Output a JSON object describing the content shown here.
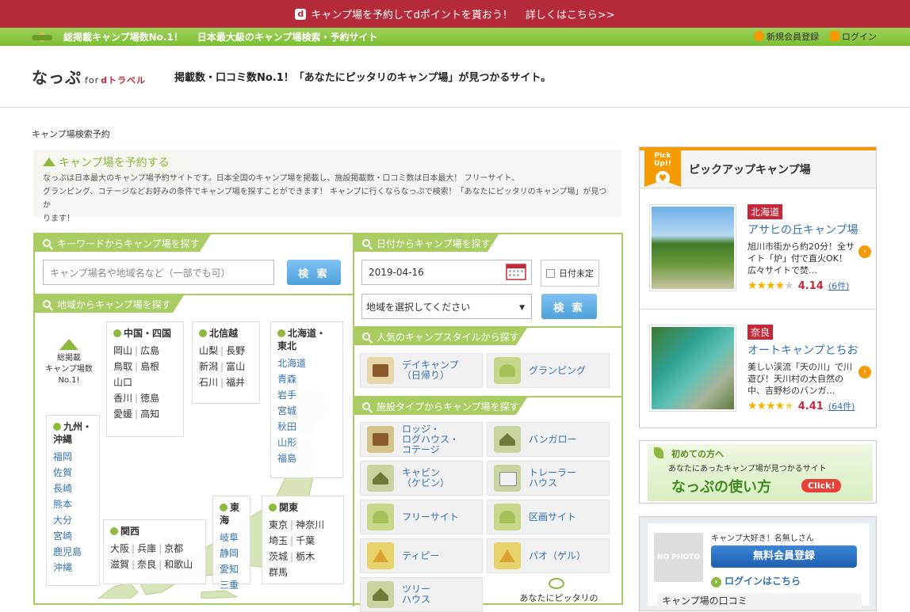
{
  "promo": {
    "icon": "d",
    "text": "キャンプ場を予約してdポイントを貰おう！",
    "more": "詳しくはこちら>>"
  },
  "topbar": {
    "catch1": "総掲載キャンプ場数No.1！",
    "catch2": "日本最大級のキャンプ場検索・予約サイト",
    "signup": "新規会員登録",
    "login": "ログイン"
  },
  "header": {
    "logo": "なっぷ",
    "logo_for": "for",
    "logo_d": "dトラベル",
    "tagline": "掲載数・口コミ数No.1！「あなたにピッタリのキャンプ場」が見つかるサイト。"
  },
  "breadcrumb": "キャンプ場検索予約",
  "intro": {
    "title": "キャンプ場を予約する",
    "line1": "なっぷは日本最大のキャンプ場予約サイトです。日本全国のキャンプ場を掲載し、施設掲載数・口コミ数は日本最大！ フリーサイト、",
    "line2": "グランピング、コテージなどお好みの条件でキャンプ場を探すことができます！ キャンプに行くならなっぷで検索！「あなたにピッタリのキャンプ場」が見つか",
    "line3": "ります！"
  },
  "keyword": {
    "header": "キーワードからキャンプ場を探す",
    "placeholder": "キャンプ場名や地域名など（一部でも可）",
    "button": "検 索"
  },
  "date": {
    "header": "日付からキャンプ場を探す",
    "value": "2019-04-16",
    "undecided": "日付未定",
    "area_placeholder": "地域を選択してください",
    "button": "検 索"
  },
  "area": {
    "header": "地域からキャンプ場を探す",
    "count_line1": "総掲載",
    "count_line2": "キャンプ場数",
    "count_line3": "No.1!"
  },
  "regions": {
    "chugoku": {
      "title": "中国・四国",
      "r1": [
        "岡山",
        "広島"
      ],
      "r2": [
        "鳥取",
        "島根"
      ],
      "r3": [
        "山口"
      ],
      "r4": [
        "香川",
        "徳島"
      ],
      "r5": [
        "愛媛",
        "高知"
      ]
    },
    "hokushinetsu": {
      "title": "北信越",
      "r1": [
        "山梨",
        "長野"
      ],
      "r2": [
        "新潟",
        "富山"
      ],
      "r3": [
        "石川",
        "福井"
      ]
    },
    "hokkaido": {
      "title1": "北海道・",
      "title2": "東北",
      "items": [
        "北海道",
        "青森",
        "岩手",
        "宮城",
        "秋田",
        "山形",
        "福島"
      ]
    },
    "kyushu": {
      "title1": "九州・",
      "title2": "沖縄",
      "items": [
        "福岡",
        "佐賀",
        "長崎",
        "熊本",
        "大分",
        "宮崎",
        "鹿児島",
        "沖縄"
      ]
    },
    "kansai": {
      "title": "関西",
      "r1": [
        "大阪",
        "兵庫",
        "京都"
      ],
      "r2": [
        "滋賀",
        "奈良",
        "和歌山"
      ]
    },
    "tokai": {
      "title": "東海",
      "items": [
        "岐阜",
        "静岡",
        "愛知",
        "三重"
      ]
    },
    "kanto": {
      "title": "関東",
      "r1": [
        "東京",
        "神奈川"
      ],
      "r2": [
        "埼玉",
        "千葉"
      ],
      "r3": [
        "茨城",
        "栃木"
      ],
      "r4": [
        "群馬"
      ]
    }
  },
  "style": {
    "header": "人気のキャンプスタイルから探す",
    "day1": "デイキャンプ",
    "day2": "（日帰り）",
    "glamping": "グランピング"
  },
  "facility": {
    "header": "施設タイプからキャンプ場を探す",
    "lodge1": "ロッジ・",
    "lodge2": "ログハウス・",
    "lodge3": "コテージ",
    "bungalow": "バンガロー",
    "cabin1": "キャビン",
    "cabin2": "（ケビン）",
    "trailer1": "トレーラー",
    "trailer2": "ハウス",
    "free": "フリーサイト",
    "kukaku": "区画サイト",
    "tipi": "ティピー",
    "pao": "パオ（ゲル）",
    "tree1": "ツリー",
    "tree2": "ハウス",
    "recommend": "あなたにピッタリの"
  },
  "pickup": {
    "badge": "Pick Up!!",
    "title": "ピックアップキャンプ場",
    "items": [
      {
        "pref": "北海道",
        "name": "アサヒの丘キャンプ場",
        "d1": "旭川市街から約20分！全サ",
        "d2": "イト「炉」付で直火OK！",
        "d3": "広々サイトで焚…",
        "score": "4.14",
        "count": "(6件)",
        "stars": 4.14
      },
      {
        "pref": "奈良",
        "name": "オートキャンプとちお",
        "d1": "美しい渓流「天の川」で川",
        "d2": "遊び！天川村の大自然の",
        "d3": "中、吉野杉のバンガ…",
        "score": "4.41",
        "count": "(64件)",
        "stars": 4.41
      }
    ]
  },
  "guide": {
    "line1": "初めての方へ",
    "line2": "あなたにあったキャンプ場が見つかるサイト",
    "line3": "なっぷの使い方",
    "click": "Click!"
  },
  "member": {
    "nophoto": "NO PHOTO",
    "hello": "キャンプ大好き！名無しさん",
    "register": "無料会員登録",
    "login": "ログインはこちら",
    "reviews": "キャンプ場の口コミ"
  }
}
